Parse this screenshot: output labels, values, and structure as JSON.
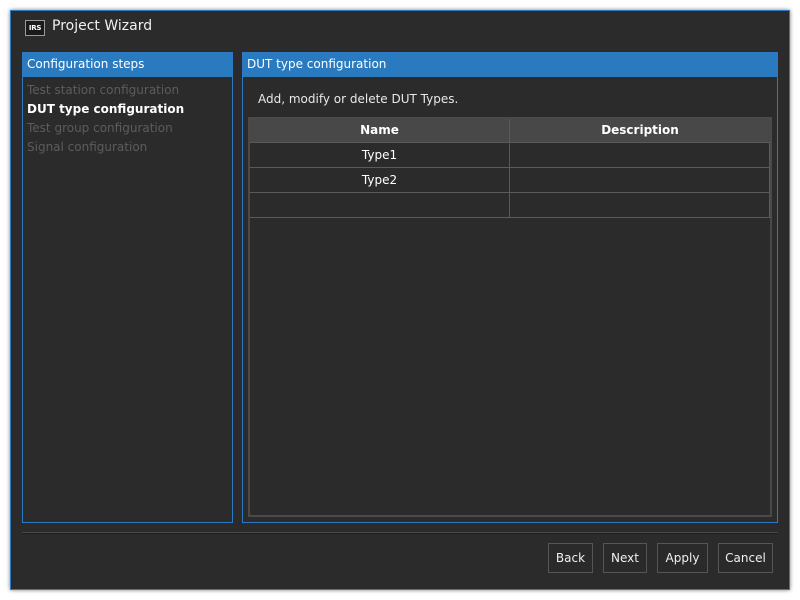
{
  "window": {
    "title": "Project Wizard",
    "logo_text": "IRS",
    "accent_color": "#2a7ac0"
  },
  "steps_panel": {
    "header": "Configuration steps",
    "items": [
      {
        "label": "Test station configuration",
        "state": "inactive"
      },
      {
        "label": "DUT type configuration",
        "state": "active"
      },
      {
        "label": "Test group configuration",
        "state": "inactive"
      },
      {
        "label": "Signal configuration",
        "state": "inactive"
      }
    ]
  },
  "content_panel": {
    "header": "DUT type configuration",
    "instruction": "Add, modify or delete DUT Types.",
    "table": {
      "columns": [
        "Name",
        "Description"
      ],
      "rows": [
        {
          "name": "Type1",
          "description": ""
        },
        {
          "name": "Type2",
          "description": ""
        },
        {
          "name": "",
          "description": ""
        }
      ]
    }
  },
  "buttons": {
    "back": "Back",
    "next": "Next",
    "apply": "Apply",
    "cancel": "Cancel"
  }
}
